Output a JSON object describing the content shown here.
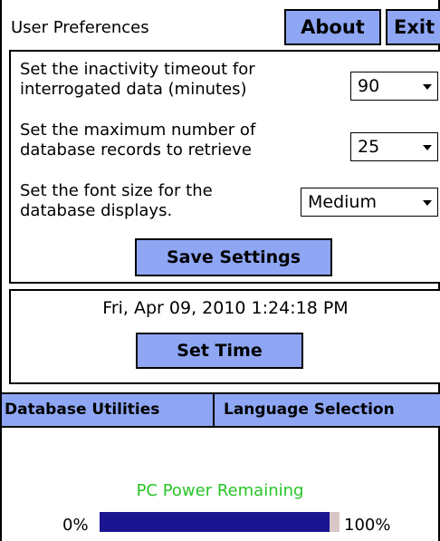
{
  "header": {
    "title": "User Preferences",
    "about_label": "About",
    "exit_label": "Exit"
  },
  "settings": {
    "inactivity": {
      "label_line1": "Set the inactivity timeout for",
      "label_line2": "interrogated data (minutes)",
      "value": "90"
    },
    "max_records": {
      "label_line1": "Set the maximum number of",
      "label_line2": "database records to retrieve",
      "value": "25"
    },
    "font_size": {
      "label_line1": "Set the font size for the",
      "label_line2": "database displays.",
      "value": "Medium"
    },
    "save_label": "Save Settings"
  },
  "time": {
    "datetime": "Fri, Apr 09, 2010 1:24:18 PM",
    "set_time_label": "Set Time"
  },
  "tabs": [
    {
      "label": "Database Utilities"
    },
    {
      "label": "Language Selection"
    }
  ],
  "power": {
    "label": "PC Power Remaining",
    "min_label": "0%",
    "max_label": "100%",
    "level": 0.96
  },
  "colors": {
    "button_bg": "#8ea6f4",
    "power_label": "#27c427",
    "power_fill": "#1b1592",
    "power_track": "#d9c7c7"
  }
}
